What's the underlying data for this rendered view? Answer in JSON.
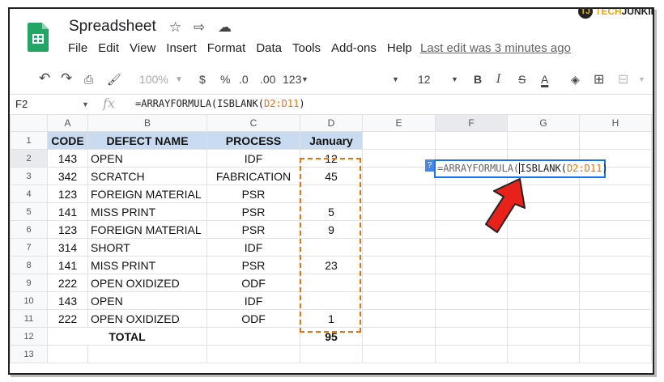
{
  "app": {
    "title": "Spreadsheet",
    "last_edit": "Last edit was 3 minutes ago",
    "brand": "TECHJUNKIE"
  },
  "menu": [
    "File",
    "Edit",
    "View",
    "Insert",
    "Format",
    "Data",
    "Tools",
    "Add-ons",
    "Help"
  ],
  "toolbar": {
    "zoom": "100%",
    "currency": "$",
    "percent": "%",
    "dec_decrease": ".0",
    "dec_increase": ".00",
    "more_formats": "123",
    "font_size": "12",
    "bold": "B",
    "italic": "I",
    "strike": "S",
    "text_color": "A"
  },
  "formula_bar": {
    "cell_ref": "F2",
    "fx": "fx",
    "prefix": "=ARRAYFORMULA(ISBLANK(",
    "range": "D2:D11",
    "suffix": ")"
  },
  "columns": [
    "A",
    "B",
    "C",
    "D",
    "E",
    "F",
    "G",
    "H"
  ],
  "rows": [
    [
      "CODE",
      "DEFECT NAME",
      "PROCESS",
      "January"
    ],
    [
      "143",
      "OPEN",
      "IDF",
      "12"
    ],
    [
      "342",
      "SCRATCH",
      "FABRICATION",
      "45"
    ],
    [
      "123",
      "FOREIGN MATERIAL",
      "PSR",
      ""
    ],
    [
      "141",
      "MISS PRINT",
      "PSR",
      "5"
    ],
    [
      "123",
      "FOREIGN MATERIAL",
      "PSR",
      "9"
    ],
    [
      "314",
      "SHORT",
      "IDF",
      ""
    ],
    [
      "141",
      "MISS PRINT",
      "PSR",
      "23"
    ],
    [
      "222",
      "OPEN OXIDIZED",
      "ODF",
      ""
    ],
    [
      "143",
      "OPEN",
      "IDF",
      ""
    ],
    [
      "222",
      "OPEN OXIDIZED",
      "ODF",
      "1"
    ]
  ],
  "total": {
    "label": "TOTAL",
    "value": "95"
  },
  "row_numbers": [
    "1",
    "2",
    "3",
    "4",
    "5",
    "6",
    "7",
    "8",
    "9",
    "10",
    "11",
    "12",
    "13"
  ],
  "editor": {
    "help": "?",
    "prefix": "=ARRAYFORMULA(",
    "fn": "ISBLANK(",
    "range": "D2:D11",
    "suffix": ")"
  },
  "colors": {
    "header_fill": "#c9dbf0",
    "range_highlight": "#e8710a",
    "edit_border": "#1a73e8",
    "arrow": "#e8221b"
  }
}
